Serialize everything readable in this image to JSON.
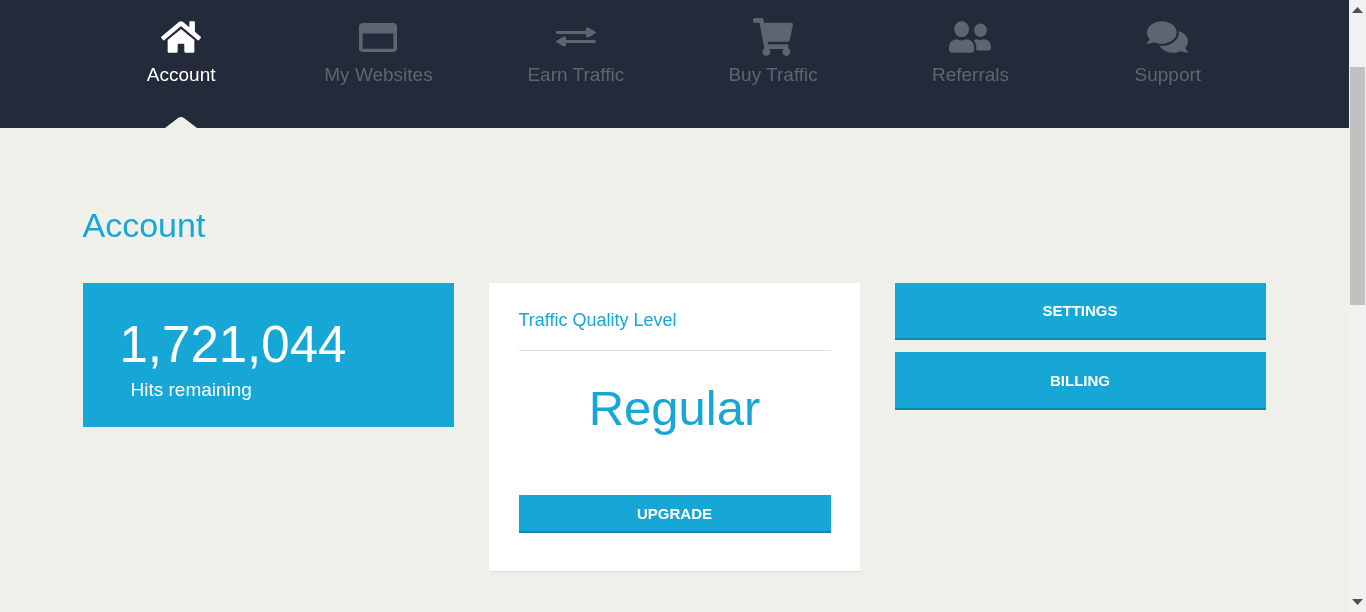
{
  "nav": [
    {
      "label": "Account",
      "selected": true
    },
    {
      "label": "My Websites",
      "selected": false
    },
    {
      "label": "Earn Traffic",
      "selected": false
    },
    {
      "label": "Buy Traffic",
      "selected": false
    },
    {
      "label": "Referrals",
      "selected": false
    },
    {
      "label": "Support",
      "selected": false
    }
  ],
  "page_title": "Account",
  "hits_card": {
    "value": "1,721,044",
    "label": "Hits remaining"
  },
  "quality_card": {
    "title": "Traffic Quality Level",
    "level_name": "Regular",
    "button": "UPGRADE"
  },
  "actions": [
    "SETTINGS",
    "BILLING"
  ]
}
